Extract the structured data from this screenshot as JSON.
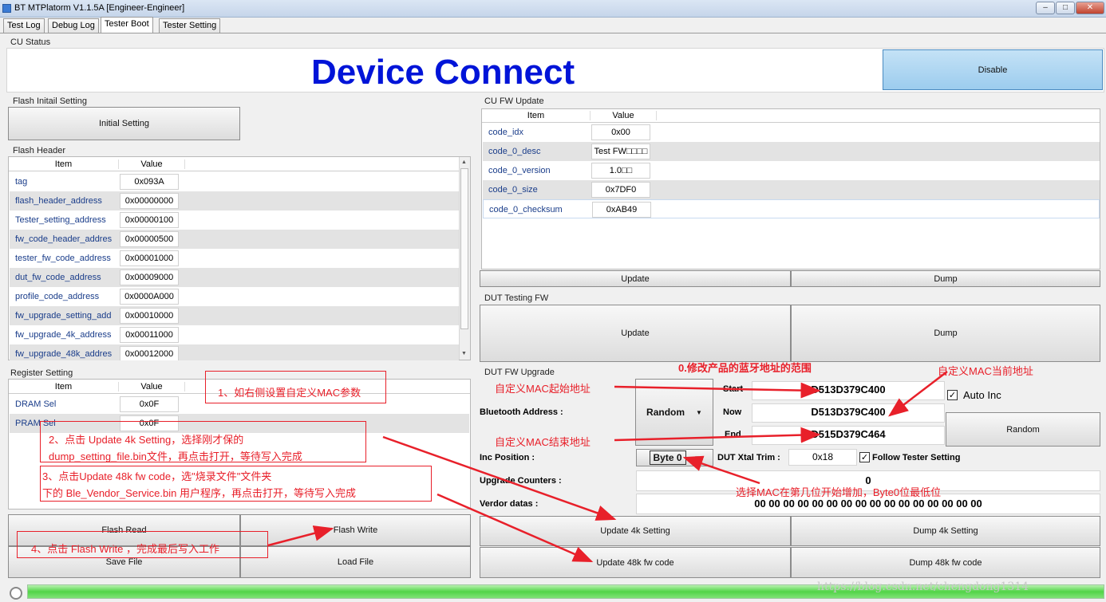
{
  "window": {
    "title": "BT MTPlatorm V1.1.5A [Engineer-Engineer]",
    "min": "–",
    "max": "□",
    "close": "✕"
  },
  "tabs": [
    {
      "label": "Test Log"
    },
    {
      "label": "Debug Log"
    },
    {
      "label": "Tester Boot"
    },
    {
      "label": "Tester Setting"
    }
  ],
  "cu_status": {
    "label": "CU Status",
    "text": "Device Connect",
    "button": "Disable",
    "accent": "#0014d8"
  },
  "flash_init": {
    "label": "Flash Initail Setting",
    "button": "Initial Setting"
  },
  "flash_header": {
    "label": "Flash Header",
    "col_item": "Item",
    "col_value": "Value",
    "rows": [
      {
        "item": "tag",
        "value": "0x093A"
      },
      {
        "item": "flash_header_address",
        "value": "0x00000000"
      },
      {
        "item": "Tester_setting_address",
        "value": "0x00000100"
      },
      {
        "item": "fw_code_header_addres",
        "value": "0x00000500"
      },
      {
        "item": "tester_fw_code_address",
        "value": "0x00001000"
      },
      {
        "item": "dut_fw_code_address",
        "value": "0x00009000"
      },
      {
        "item": "profile_code_address",
        "value": "0x0000A000"
      },
      {
        "item": "fw_upgrade_setting_add",
        "value": "0x00010000"
      },
      {
        "item": "fw_upgrade_4k_address",
        "value": "0x00011000"
      },
      {
        "item": "fw_upgrade_48k_addres",
        "value": "0x00012000"
      }
    ]
  },
  "register": {
    "label": "Register Setting",
    "col_item": "Item",
    "col_value": "Value",
    "rows": [
      {
        "item": "DRAM Sel",
        "value": "0x0F"
      },
      {
        "item": "PRAM Sel",
        "value": "0x0F"
      }
    ]
  },
  "bottom_left": {
    "flash_read": "Flash Read",
    "flash_write": "Flash Write",
    "save_file": "Save File",
    "load_file": "Load File"
  },
  "cu_fw": {
    "label": "CU FW Update",
    "col_item": "Item",
    "col_value": "Value",
    "rows": [
      {
        "item": "code_idx",
        "value": "0x00"
      },
      {
        "item": "code_0_desc",
        "value": "Test FW□□□□"
      },
      {
        "item": "code_0_version",
        "value": "1.0□□"
      },
      {
        "item": "code_0_size",
        "value": "0x7DF0"
      },
      {
        "item": "code_0_checksum",
        "value": "0xAB49"
      }
    ],
    "update": "Update",
    "dump": "Dump"
  },
  "dut_testing": {
    "label": "DUT Testing FW",
    "update": "Update",
    "dump": "Dump"
  },
  "dut_upgrade": {
    "label": "DUT FW Upgrade",
    "bt_address_label": "Bluetooth Address :",
    "random_select": "Random",
    "start_label": "Start",
    "start": "D513D379C400",
    "now_label": "Now",
    "now": "D513D379C400",
    "end_label": "End",
    "end": "D515D379C464",
    "auto_inc": "Auto Inc",
    "random_button": "Random",
    "inc_position_label": "Inc Position :",
    "inc_position": "Byte 0",
    "xtal_label": "DUT Xtal Trim :",
    "xtal": "0x18",
    "follow": "Follow Tester Setting",
    "counters_label": "Upgrade Counters :",
    "counters": "0",
    "vendor_label": "Verdor datas :",
    "vendor": "00 00 00 00 00 00 00 00 00 00 00 00 00 00 00 00",
    "update4k": "Update 4k Setting",
    "dump4k": "Dump 4k Setting",
    "update48k": "Update 48k fw code",
    "dump48k": "Dump 48k fw code"
  },
  "annotations": {
    "a0": "0.修改产品的蓝牙地址的范围",
    "a_now": "自定义MAC当前地址",
    "a_start": "自定义MAC起始地址",
    "a_end": "自定义MAC结束地址",
    "a_byte": "选择MAC在第几位开始增加，Byte0位最低位",
    "a1": "1、如右侧设置自定义MAC参数",
    "a2_l1": "2、点击 Update 4k Setting，选择刚才保的",
    "a2_l2": "dump_setting_file.bin文件，再点击打开，等待写入完成",
    "a3_l1": "3、点击Update 48k fw code，选\"烧录文件\"文件夹",
    "a3_l2": "下的 Ble_Vendor_Service.bin 用户程序，再点击打开，等待写入完成",
    "a4": "4、点击 Flash Write ，完成最后写入工作",
    "color": "#e8202a"
  },
  "watermark": "https://blog.csdn.net/chengdong1314"
}
